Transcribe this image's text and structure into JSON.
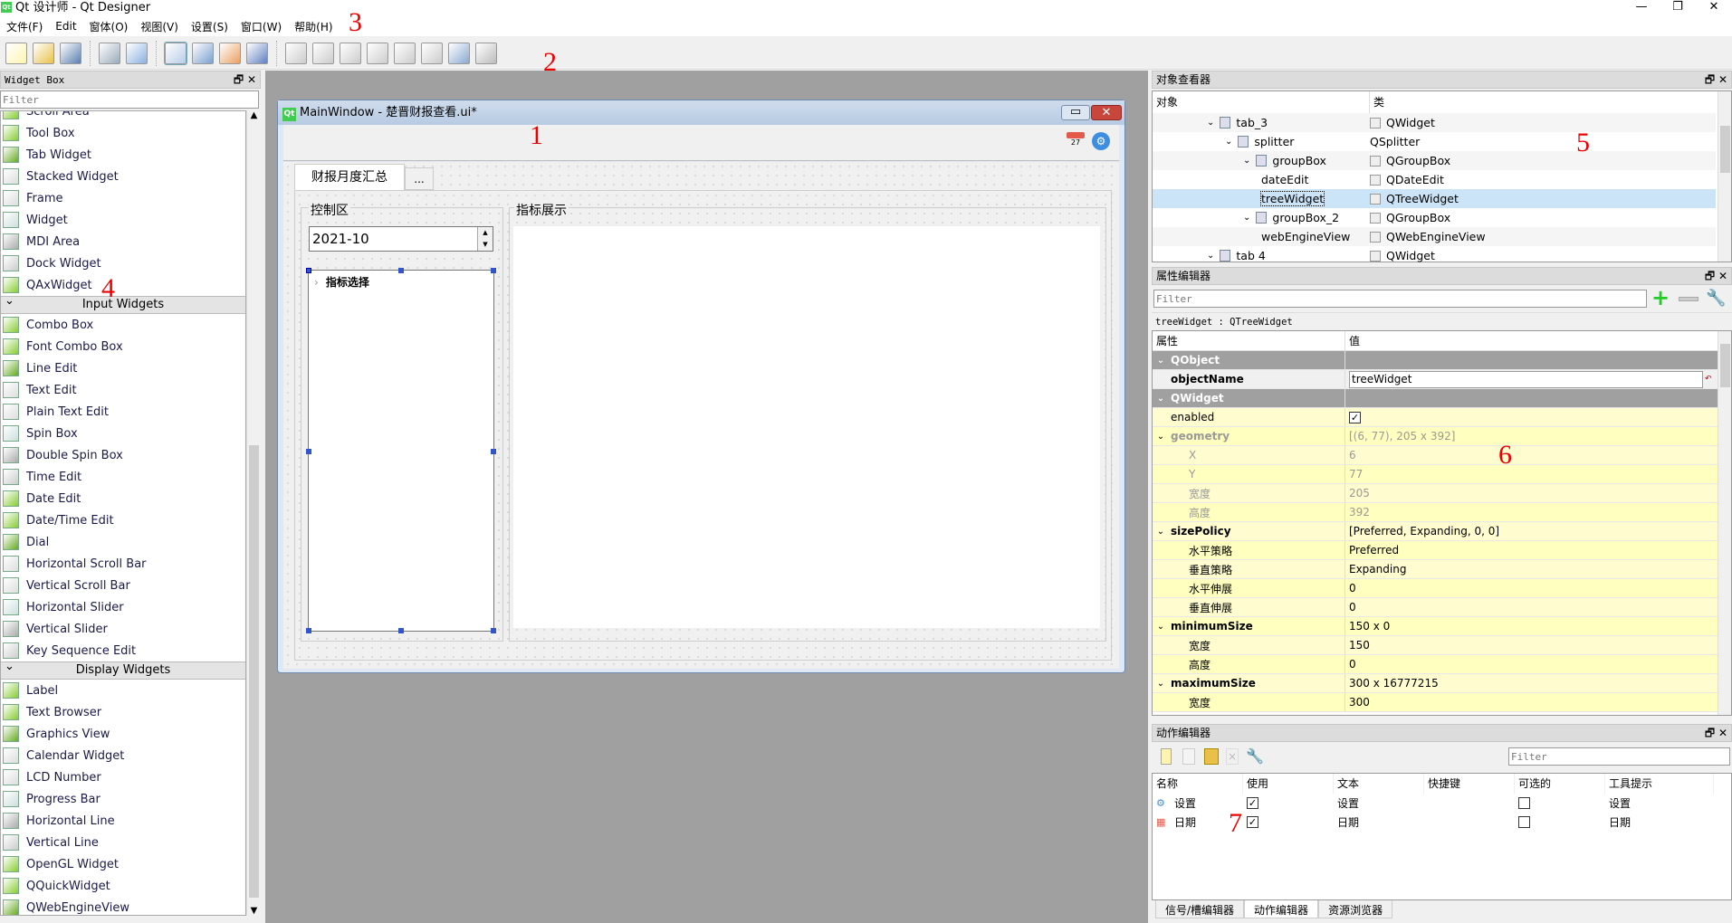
{
  "app": {
    "title": "Qt 设计师 - Qt Designer",
    "logo": "Qt"
  },
  "menu": [
    "文件(F)",
    "Edit",
    "窗体(O)",
    "视图(V)",
    "设置(S)",
    "窗口(W)",
    "帮助(H)"
  ],
  "toolbar_icons": [
    "new-file",
    "open-folder",
    "save",
    "send-to-back",
    "bring-to-front",
    "edit-widgets",
    "edit-signals-slots",
    "edit-buddies",
    "edit-tab-order",
    "layout-horizontal",
    "layout-vertical",
    "layout-h-splitter",
    "layout-v-splitter",
    "layout-grid",
    "layout-form",
    "break-layout",
    "adjust-size"
  ],
  "annotations": [
    "1",
    "2",
    "3",
    "4",
    "5",
    "6",
    "7"
  ],
  "widget_box": {
    "title": "Widget Box",
    "filter_placeholder": "Filter",
    "containers": [
      "Scroll Area",
      "Tool Box",
      "Tab Widget",
      "Stacked Widget",
      "Frame",
      "Widget",
      "MDI Area",
      "Dock Widget",
      "QAxWidget"
    ],
    "input_title": "Input Widgets",
    "input": [
      "Combo Box",
      "Font Combo Box",
      "Line Edit",
      "Text Edit",
      "Plain Text Edit",
      "Spin Box",
      "Double Spin Box",
      "Time Edit",
      "Date Edit",
      "Date/Time Edit",
      "Dial",
      "Horizontal Scroll Bar",
      "Vertical Scroll Bar",
      "Horizontal Slider",
      "Vertical Slider",
      "Key Sequence Edit"
    ],
    "display_title": "Display Widgets",
    "display": [
      "Label",
      "Text Browser",
      "Graphics View",
      "Calendar Widget",
      "LCD Number",
      "Progress Bar",
      "Horizontal Line",
      "Vertical Line",
      "OpenGL Widget",
      "QQuickWidget",
      "QWebEngineView"
    ]
  },
  "form": {
    "title": "MainWindow - 楚晋财报查看.ui*",
    "logo": "Qt",
    "calendar_day": "27",
    "tabs": [
      "财报月度汇总",
      "..."
    ],
    "control_group": "控制区",
    "date_value": "2021-10",
    "tree_item": "指标选择",
    "display_group": "指标展示"
  },
  "object_inspector": {
    "title": "对象查看器",
    "headers": [
      "对象",
      "类"
    ],
    "rows": [
      {
        "name": "tab_3",
        "cls": "QWidget",
        "level": 0,
        "expanded": true
      },
      {
        "name": "splitter",
        "cls": "QSplitter",
        "level": 1,
        "expanded": true
      },
      {
        "name": "groupBox",
        "cls": "QGroupBox",
        "level": 2,
        "expanded": true
      },
      {
        "name": "dateEdit",
        "cls": "QDateEdit",
        "level": 3,
        "expanded": null
      },
      {
        "name": "treeWidget",
        "cls": "QTreeWidget",
        "level": 3,
        "expanded": null,
        "selected": true
      },
      {
        "name": "groupBox_2",
        "cls": "QGroupBox",
        "level": 2,
        "expanded": true
      },
      {
        "name": "webEngineView",
        "cls": "QWebEngineView",
        "level": 3,
        "expanded": null
      },
      {
        "name": "tab 4",
        "cls": "QWidget",
        "level": 0,
        "expanded": true
      }
    ]
  },
  "property_editor": {
    "title": "属性编辑器",
    "filter_placeholder": "Filter",
    "class_label": "treeWidget : QTreeWidget",
    "headers": [
      "属性",
      "值"
    ],
    "rows": [
      {
        "type": "cat",
        "name": "QObject"
      },
      {
        "type": "edit",
        "name": "objectName",
        "value": "treeWidget"
      },
      {
        "type": "cat",
        "name": "QWidget"
      },
      {
        "type": "prop",
        "name": "enabled",
        "value": "",
        "checked": true
      },
      {
        "type": "group",
        "name": "geometry",
        "value": "[(6, 77), 205 x 392]",
        "dim": true
      },
      {
        "type": "sub",
        "name": "X",
        "value": "6",
        "dim": true
      },
      {
        "type": "sub",
        "name": "Y",
        "value": "77",
        "dim": true
      },
      {
        "type": "sub",
        "name": "宽度",
        "value": "205",
        "dim": true
      },
      {
        "type": "sub",
        "name": "高度",
        "value": "392",
        "dim": true
      },
      {
        "type": "group",
        "name": "sizePolicy",
        "value": "[Preferred, Expanding, 0, 0]"
      },
      {
        "type": "sub",
        "name": "水平策略",
        "value": "Preferred"
      },
      {
        "type": "sub",
        "name": "垂直策略",
        "value": "Expanding"
      },
      {
        "type": "sub",
        "name": "水平伸展",
        "value": "0"
      },
      {
        "type": "sub",
        "name": "垂直伸展",
        "value": "0"
      },
      {
        "type": "group",
        "name": "minimumSize",
        "value": "150 x 0"
      },
      {
        "type": "sub",
        "name": "宽度",
        "value": "150"
      },
      {
        "type": "sub",
        "name": "高度",
        "value": "0"
      },
      {
        "type": "group",
        "name": "maximumSize",
        "value": "300 x 16777215"
      },
      {
        "type": "sub",
        "name": "宽度",
        "value": "300"
      }
    ]
  },
  "action_editor": {
    "title": "动作编辑器",
    "filter_placeholder": "Filter",
    "headers": [
      "名称",
      "使用",
      "文本",
      "快捷键",
      "可选的",
      "工具提示"
    ],
    "rows": [
      {
        "name": "设置",
        "icon": "gear",
        "used": true,
        "text": "设置",
        "shortcut": "",
        "checkable": false,
        "tooltip": "设置"
      },
      {
        "name": "日期",
        "icon": "calendar",
        "used": true,
        "text": "日期",
        "shortcut": "",
        "checkable": false,
        "tooltip": "日期"
      }
    ],
    "bottom_tabs": [
      "信号/槽编辑器",
      "动作编辑器",
      "资源浏览器"
    ],
    "active_tab": 1
  },
  "colors": {
    "selection": "#cce4f7",
    "property_yellow": "#ffffbf",
    "category_gray": "#a0a0a0",
    "annotation": "#ee0000",
    "qt_green": "#41cd52"
  }
}
